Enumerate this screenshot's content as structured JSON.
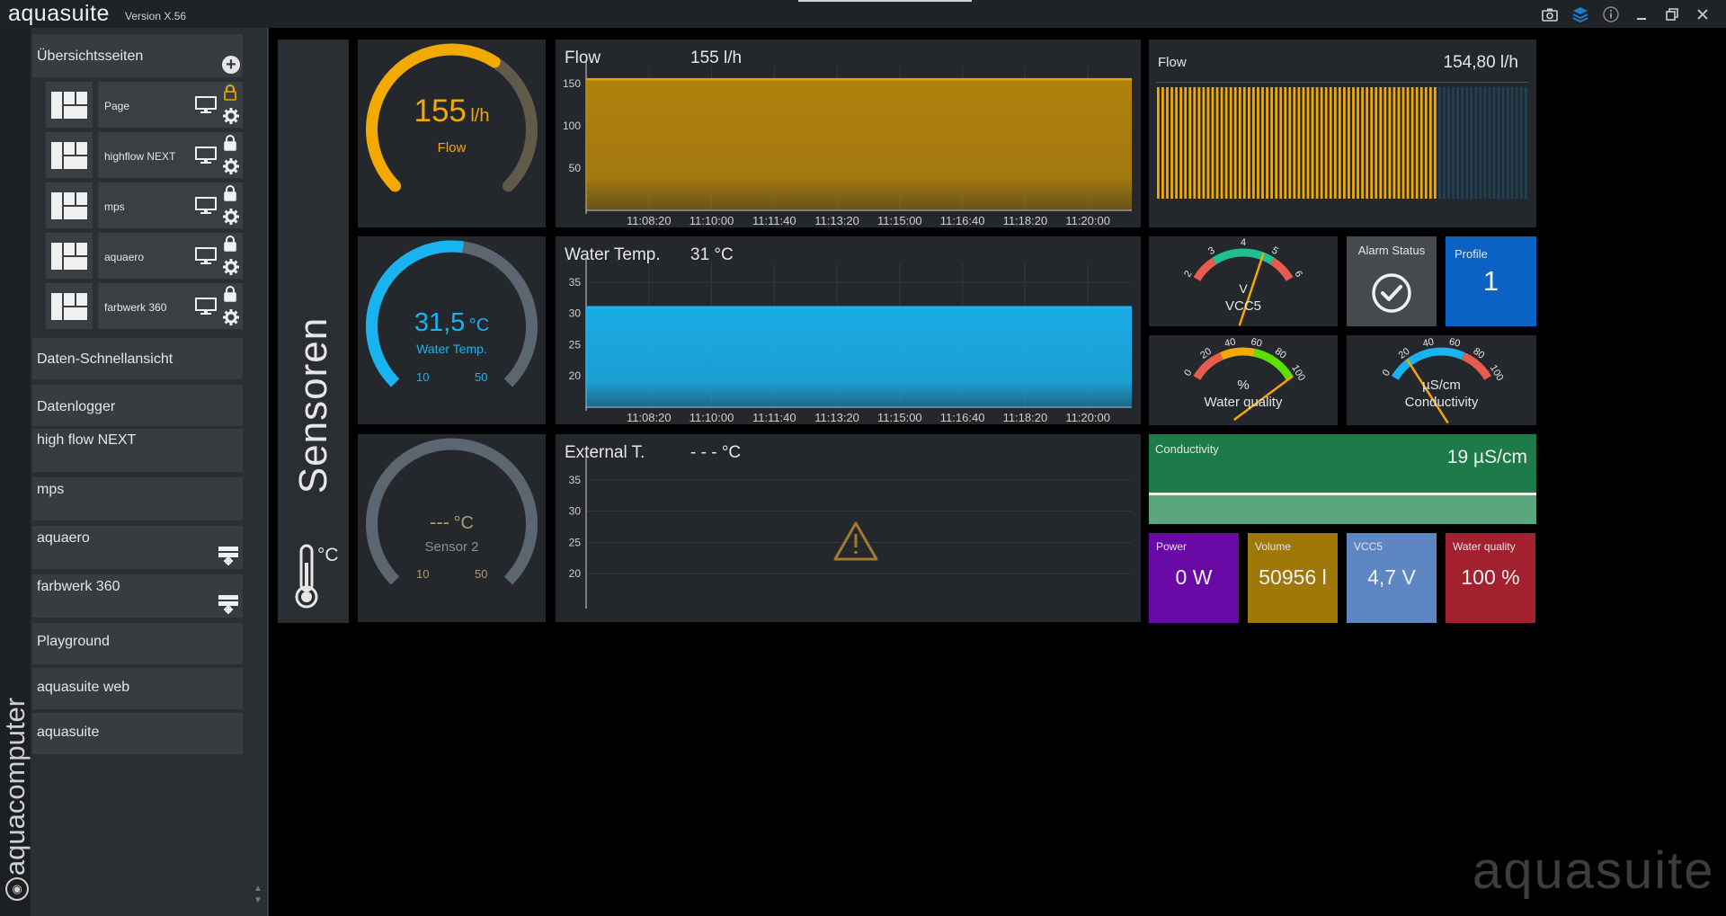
{
  "app": {
    "name": "aquasuite",
    "version": "Version X.56",
    "watermark": "aquasuite",
    "brand": "aquacomputer"
  },
  "titlebar": {
    "icons": [
      "camera-icon",
      "layers-icon",
      "info-icon",
      "minimize-icon",
      "restore-icon",
      "close-icon"
    ]
  },
  "sidebar": {
    "header": "Übersichtsseiten",
    "pages": [
      {
        "label": "Page",
        "locked": false
      },
      {
        "label": "highflow NEXT",
        "locked": true
      },
      {
        "label": "mps",
        "locked": true
      },
      {
        "label": "aquaero",
        "locked": true
      },
      {
        "label": "farbwerk 360",
        "locked": true
      }
    ],
    "items": [
      {
        "label": "Daten-Schnellansicht"
      },
      {
        "label": "Datenlogger"
      },
      {
        "label": "high flow NEXT"
      },
      {
        "label": "mps"
      },
      {
        "label": "aquaero"
      },
      {
        "label": "farbwerk 360"
      },
      {
        "label": "Playground"
      },
      {
        "label": "aquasuite web"
      },
      {
        "label": "aquasuite"
      }
    ],
    "accent": "#f2a900"
  },
  "sensor_strip": {
    "title": "Sensoren",
    "unit": "°C"
  },
  "gauges": [
    {
      "value": "155",
      "unit": "l/h",
      "label": "Flow",
      "fraction": 0.62,
      "color": "#f2a900"
    },
    {
      "value": "31,5",
      "unit": "°C",
      "label": "Water Temp.",
      "min": "10",
      "max": "50",
      "fraction": 0.53,
      "color": "#19b3ef"
    },
    {
      "value": "---",
      "unit": "°C",
      "label": "Sensor 2",
      "min": "10",
      "max": "50",
      "fraction": 0,
      "color": "#b09a70"
    }
  ],
  "charts": {
    "flow": {
      "title": "Flow",
      "value": "155 l/h"
    },
    "water": {
      "title": "Water Temp.",
      "value": "31 °C"
    },
    "external": {
      "title": "External T.",
      "value": "- - - °C"
    }
  },
  "chart_data": [
    {
      "type": "area",
      "title": "Flow",
      "x": [
        "11:08:20",
        "11:10:00",
        "11:11:40",
        "11:13:20",
        "11:15:00",
        "11:16:40",
        "11:18:20",
        "11:20:00"
      ],
      "y_ticks": [
        150,
        100,
        50
      ],
      "ylim": [
        0,
        170
      ],
      "series": [
        {
          "values": [
            155,
            155,
            155,
            155,
            155,
            155,
            155,
            155
          ]
        }
      ],
      "color": "#b8860b"
    },
    {
      "type": "area",
      "title": "Water Temp.",
      "x": [
        "11:08:20",
        "11:10:00",
        "11:11:40",
        "11:13:20",
        "11:15:00",
        "11:16:40",
        "11:18:20",
        "11:20:00"
      ],
      "y_ticks": [
        35,
        30,
        25,
        20
      ],
      "ylim": [
        15,
        38
      ],
      "series": [
        {
          "values": [
            31,
            31,
            31,
            31,
            31,
            31,
            31,
            31
          ]
        }
      ],
      "color": "#19b3ef"
    },
    {
      "type": "line",
      "title": "External T.",
      "x": [],
      "y_ticks": [
        35,
        30,
        25,
        20
      ],
      "ylim": [
        15,
        38
      ],
      "series": []
    }
  ],
  "flow_bar": {
    "label": "Flow",
    "value": "154,80 l/h",
    "fill_fraction": 0.76
  },
  "dials": [
    {
      "unit": "V",
      "label": "VCC5",
      "ticks": [
        "2",
        "3",
        "4",
        "5",
        "6"
      ],
      "value": 4.7,
      "min": 2,
      "max": 6
    },
    {
      "unit": "%",
      "label": "Water quality",
      "ticks": [
        "0",
        "20",
        "40",
        "60",
        "80",
        "100"
      ],
      "value": 100,
      "min": 0,
      "max": 100
    },
    {
      "unit": "µS/cm",
      "label": "Conductivity",
      "ticks": [
        "0",
        "20",
        "40",
        "60",
        "80",
        "100"
      ],
      "value": 19,
      "min": 0,
      "max": 100
    }
  ],
  "alarm": {
    "label": "Alarm Status"
  },
  "profile": {
    "label": "Profile",
    "value": "1"
  },
  "conductivity_panel": {
    "label": "Conductivity",
    "value": "19 µS/cm"
  },
  "tiles": [
    {
      "label": "Power",
      "value": "0 W",
      "color": "#6a0aa6"
    },
    {
      "label": "Volume",
      "value": "50956 l",
      "color": "#a0780a"
    },
    {
      "label": "VCC5",
      "value": "4,7 V",
      "color": "#5d86c3"
    },
    {
      "label": "Water quality",
      "value": "100 %",
      "color": "#a3202e"
    }
  ]
}
